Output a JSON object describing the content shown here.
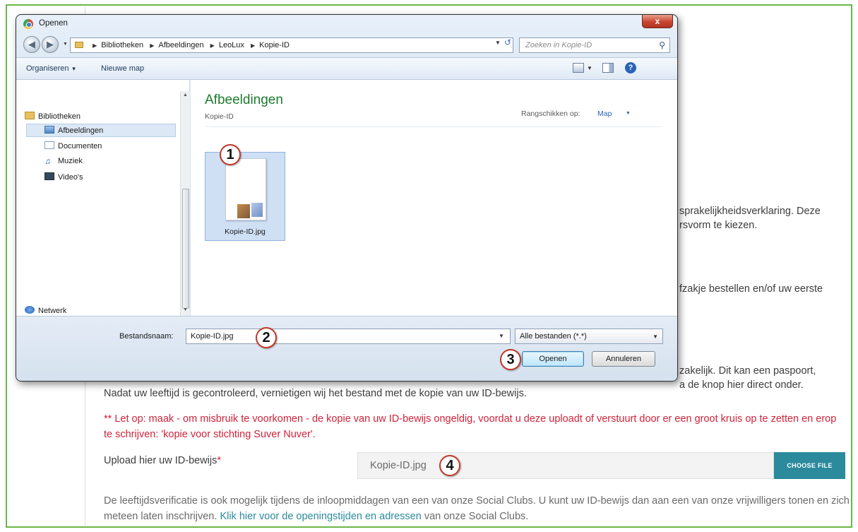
{
  "background_page": {
    "text_right_1a": "sprakelijkheidsverklaring. Deze",
    "text_right_1b": "rsvorm te kiezen.",
    "text_right_2": "fzakje bestellen en/of uw eerste",
    "text_right_3": "zakelijk. Dit kan een paspoort,",
    "text_right_4": "a de knop hier direct onder.",
    "line_verify": "Nadat uw leeftijd is gecontroleerd, vernietigen wij het bestand met de kopie van uw ID-bewijs.",
    "warning": "** Let op: maak - om misbruik te voorkomen - de kopie van uw ID-bewijs ongeldig, voordat u deze uploadt of verstuurt door er een groot kruis op te zetten en erop te schrijven: 'kopie voor stichting Suver Nuver'.",
    "upload_label": "Upload hier uw ID-bewijs",
    "upload_required": "*",
    "file_value": "Kopie-ID.jpg",
    "choose_file": "CHOOSE FILE",
    "info_text": "De leeftijdsverificatie is ook mogelijk tijdens de inloopmiddagen van een van onze Social Clubs. U kunt uw ID-bewijs dan aan een van onze vrijwilligers tonen en zich meteen laten inschrijven.",
    "info_link": "Klik hier voor de openingstijden en adressen",
    "info_tail": "van onze Social Clubs."
  },
  "dialog": {
    "title": "Openen",
    "close_label": "x",
    "breadcrumbs": [
      "Bibliotheken",
      "Afbeeldingen",
      "LeoLux",
      "Kopie-ID"
    ],
    "search_placeholder": "Zoeken in Kopie-ID",
    "toolbar": {
      "organize": "Organiseren",
      "new_folder": "Nieuwe map"
    },
    "nav": {
      "libraries": "Bibliotheken",
      "pictures": "Afbeeldingen",
      "documents": "Documenten",
      "music": "Muziek",
      "videos": "Video's",
      "network": "Netwerk"
    },
    "content": {
      "title": "Afbeeldingen",
      "subtitle": "Kopie-ID",
      "arrange_label": "Rangschikken op:",
      "arrange_value": "Map",
      "file_name": "Kopie-ID.jpg"
    },
    "filename_label": "Bestandsnaam:",
    "filename_value": "Kopie-ID.jpg",
    "filetype": "Alle bestanden (*.*)",
    "open_button": "Openen",
    "cancel_button": "Annuleren"
  },
  "callouts": [
    "1",
    "2",
    "3",
    "4"
  ],
  "colors": {
    "frame": "#6bb64a",
    "warning": "#d0233a",
    "accent": "#2b8a9c",
    "content_title": "#1e7a2e"
  }
}
